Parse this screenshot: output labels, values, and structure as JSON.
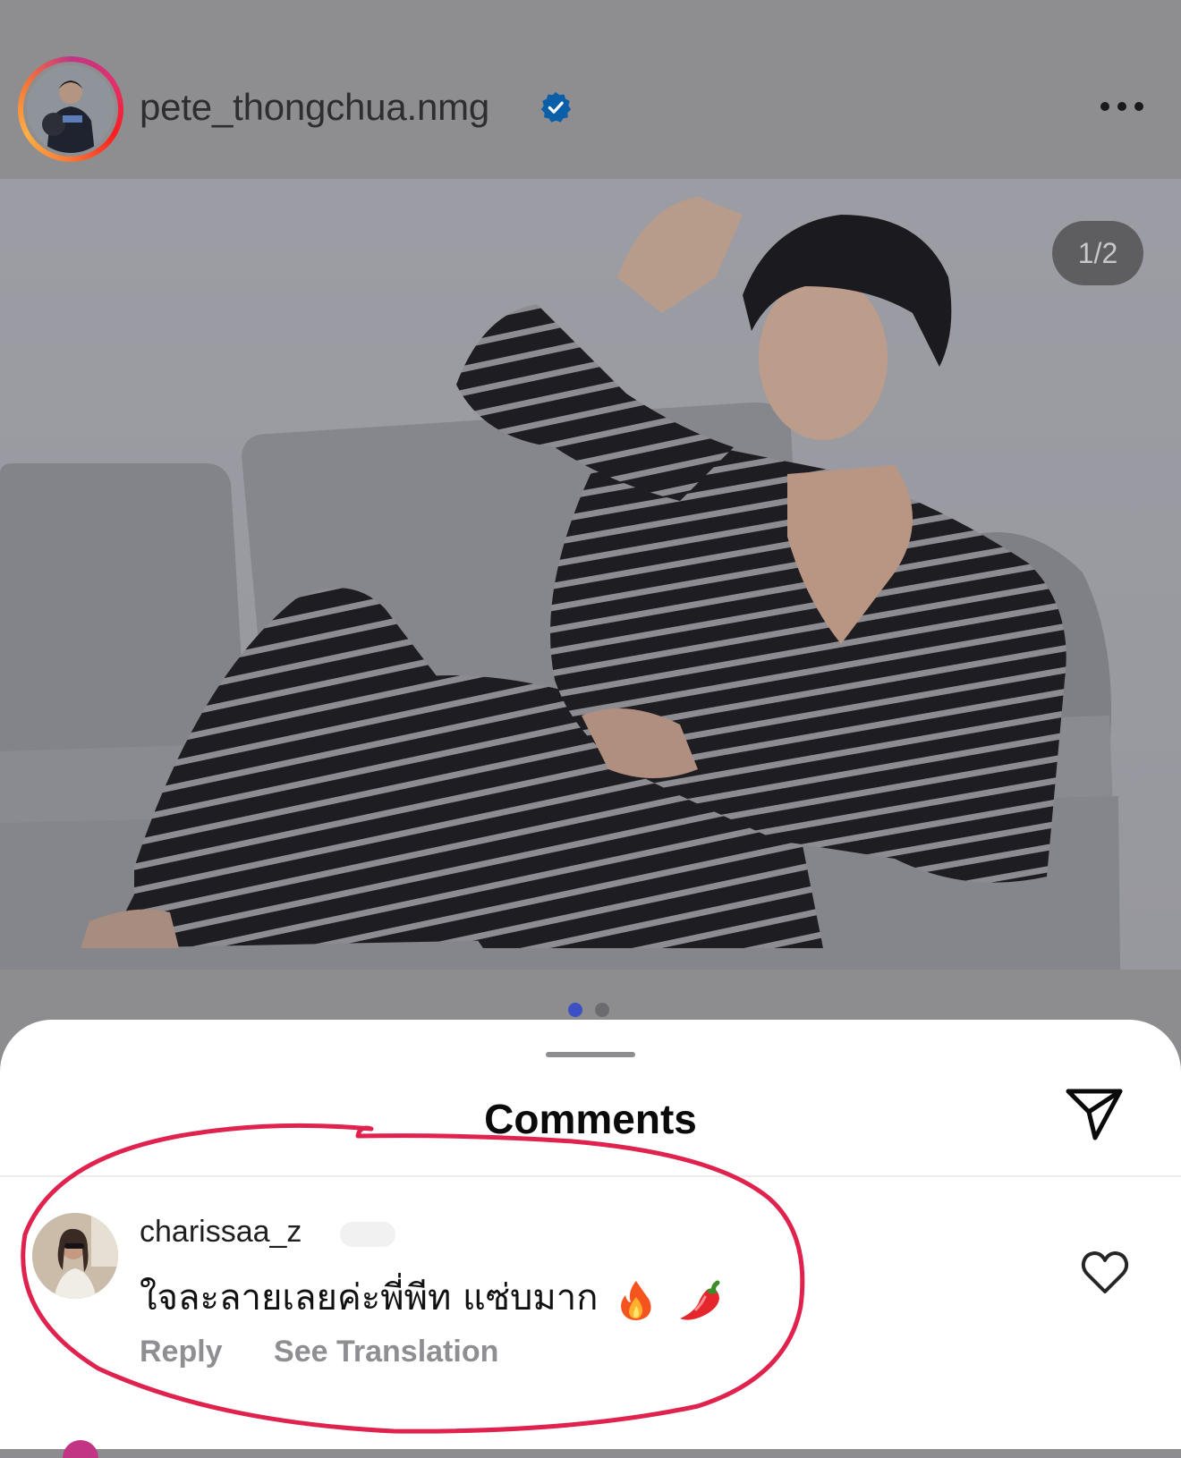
{
  "post": {
    "username": "pete_thongchua.nmg",
    "verified_icon": "verified-badge-icon",
    "more_icon": "more-options-icon",
    "image_counter": "1/2",
    "carousel": {
      "total": 2,
      "active_index": 0
    }
  },
  "comments_sheet": {
    "title": "Comments",
    "share_icon": "paper-plane-icon",
    "comment": {
      "username": "charissaa_z",
      "text": "ใจละลายเลยค่ะพี่พีท แซ่บมาก",
      "emojis": [
        "fire-emoji",
        "chili-emoji"
      ],
      "reply_label": "Reply",
      "translation_label": "See Translation",
      "like_icon": "heart-outline-icon"
    }
  },
  "colors": {
    "overlay_gray": "#8e8e90",
    "verified_blue": "#0b5ea8",
    "carousel_active": "#3d50c4",
    "carousel_inactive": "#6b6b70",
    "highlight_red": "#e0234e",
    "secondary_text": "#8e8e93"
  }
}
